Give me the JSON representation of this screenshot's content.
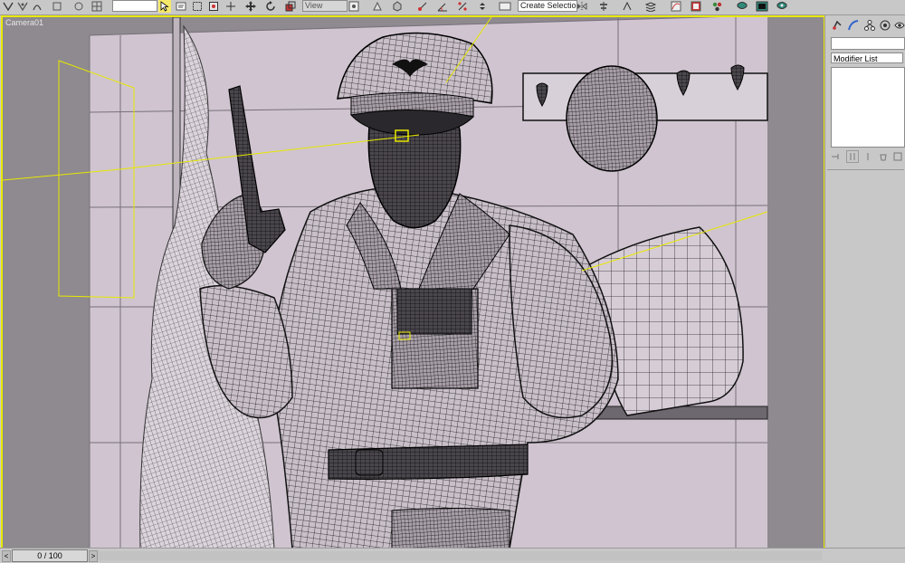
{
  "toolbar": {
    "selection_filter": "",
    "reference_coordinate": "View",
    "named_selection_set": "Create Selection Set",
    "tools": [
      "select-icon",
      "select-by-name-icon",
      "select-region-icon",
      "window-crossing-icon",
      "move-icon",
      "rotate-icon",
      "scale-icon",
      "pivot-icon",
      "snap-icon",
      "angle-snap-icon",
      "percent-snap-icon",
      "spinner-snap-icon",
      "mirror-icon",
      "align-icon",
      "layer-manager-icon",
      "curve-editor-icon",
      "schematic-view-icon",
      "material-editor-icon",
      "render-setup-icon",
      "rendered-frame-icon",
      "quick-render-icon"
    ]
  },
  "viewport": {
    "label": "Camera01",
    "active_border_color": "#e8e800",
    "background_color": "#8e8a8f",
    "wall_color": "#cfc4cf",
    "wire_color": "#1a1a1a",
    "selection_color": "#e8e800"
  },
  "command_panel": {
    "tabs": [
      "create-icon",
      "modify-icon",
      "hierarchy-icon",
      "motion-icon",
      "display-icon"
    ],
    "object_name": "",
    "modifier_list_label": "Modifier List",
    "stack_tools": [
      "pin-stack-icon",
      "show-end-result-icon",
      "make-unique-icon",
      "remove-modifier-icon",
      "configure-modifier-sets-icon"
    ]
  },
  "timeline": {
    "frame_display": "0 / 100",
    "prev_label": "<",
    "next_label": ">"
  }
}
